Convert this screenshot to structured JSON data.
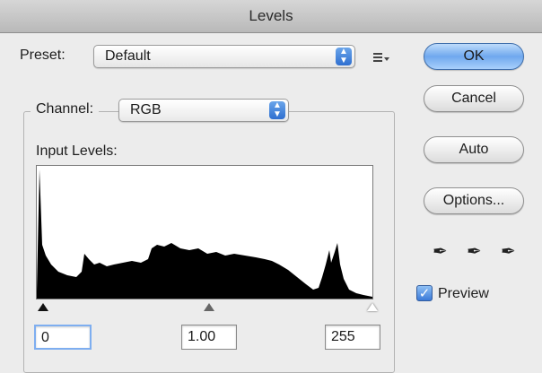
{
  "window": {
    "title": "Levels"
  },
  "preset": {
    "label": "Preset:",
    "value": "Default"
  },
  "channel": {
    "label": "Channel:",
    "value": "RGB"
  },
  "input_levels": {
    "label": "Input Levels:",
    "black": "0",
    "gamma": "1.00",
    "white": "255"
  },
  "buttons": {
    "ok": "OK",
    "cancel": "Cancel",
    "auto": "Auto",
    "options": "Options..."
  },
  "preview": {
    "label": "Preview",
    "checked": true
  },
  "icons": {
    "preset_menu": "list-menu-icon",
    "droppers": [
      "black-eyedropper-icon",
      "gray-eyedropper-icon",
      "white-eyedropper-icon"
    ]
  }
}
